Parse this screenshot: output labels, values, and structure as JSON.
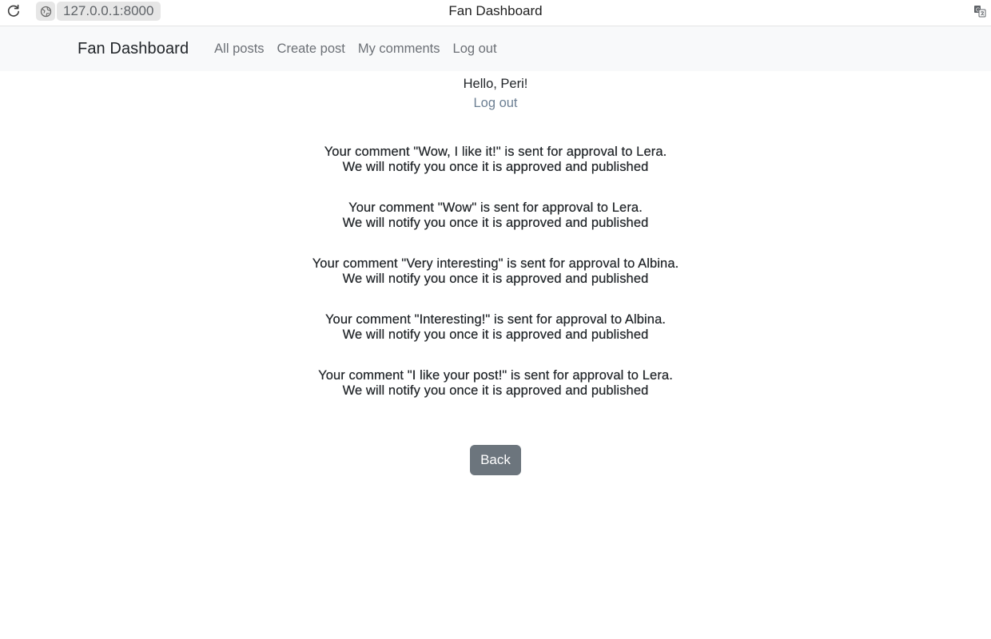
{
  "browser": {
    "url": "127.0.0.1:8000",
    "window_title": "Fan Dashboard"
  },
  "navbar": {
    "brand": "Fan Dashboard",
    "links": [
      "All posts",
      "Create post",
      "My comments",
      "Log out"
    ]
  },
  "main": {
    "greeting": "Hello, Peri!",
    "logout_label": "Log out",
    "messages": [
      {
        "line1": "Your comment \"Wow, I like it!\" is sent for approval to Lera.",
        "line2": "We will notify you once it is approved and published"
      },
      {
        "line1": "Your comment \"Wow\" is sent for approval to Lera.",
        "line2": "We will notify you once it is approved and published"
      },
      {
        "line1": "Your comment \"Very interesting\" is sent for approval to Albina.",
        "line2": "We will notify you once it is approved and published"
      },
      {
        "line1": "Your comment \"Interesting!\" is sent for approval to Albina.",
        "line2": "We will notify you once it is approved and published"
      },
      {
        "line1": "Your comment \"I like your post!\" is sent for approval to Lera.",
        "line2": "We will notify you once it is approved and published"
      }
    ],
    "back_label": "Back"
  },
  "colors": {
    "navbar_bg": "#f8f9fa",
    "nav_link": "#6c7076",
    "button_bg": "#6c757d",
    "text": "#212529"
  },
  "icons": {
    "reload": "reload-icon",
    "site": "site-info-icon",
    "translate": "translate-icon"
  }
}
